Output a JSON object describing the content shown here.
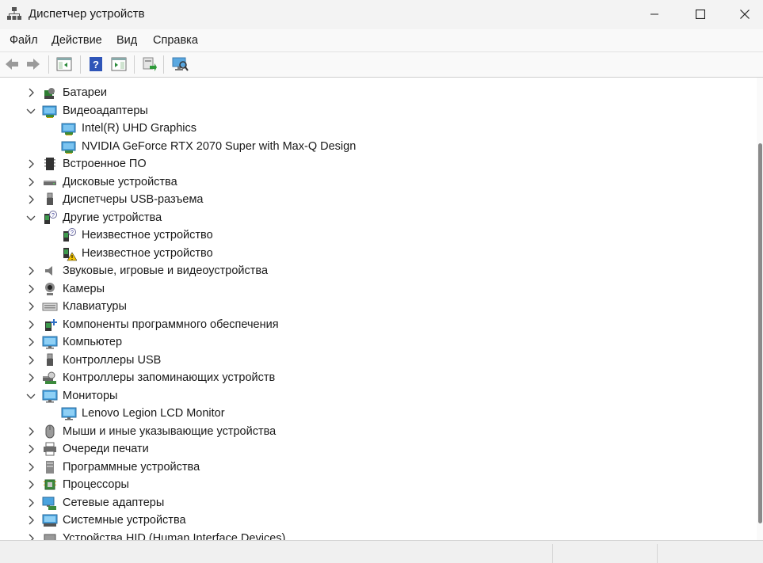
{
  "window": {
    "title": "Диспетчер устройств"
  },
  "menu": [
    "Файл",
    "Действие",
    "Вид",
    "Справка"
  ],
  "tree": [
    {
      "label": "Батареи",
      "expander": "collapsed",
      "icon": "battery-icon"
    },
    {
      "label": "Видеоадаптеры",
      "expander": "expanded",
      "icon": "display-adapter-icon"
    },
    {
      "label": "Intel(R) UHD Graphics",
      "expander": "none",
      "child": true,
      "icon": "display-adapter-icon"
    },
    {
      "label": "NVIDIA GeForce RTX 2070 Super with Max-Q Design",
      "expander": "none",
      "child": true,
      "icon": "display-adapter-icon"
    },
    {
      "label": "Встроенное ПО",
      "expander": "collapsed",
      "icon": "firmware-chip-icon"
    },
    {
      "label": "Дисковые устройства",
      "expander": "collapsed",
      "icon": "disk-drive-icon"
    },
    {
      "label": "Диспетчеры USB-разъема",
      "expander": "collapsed",
      "icon": "usb-connector-icon"
    },
    {
      "label": "Другие устройства",
      "expander": "expanded",
      "icon": "unknown-device-icon"
    },
    {
      "label": "Неизвестное устройство",
      "expander": "none",
      "child": true,
      "icon": "unknown-device-icon"
    },
    {
      "label": "Неизвестное устройство",
      "expander": "none",
      "child": true,
      "icon": "warning-device-icon"
    },
    {
      "label": "Звуковые, игровые и видеоустройства",
      "expander": "collapsed",
      "icon": "speaker-icon"
    },
    {
      "label": "Камеры",
      "expander": "collapsed",
      "icon": "webcam-icon"
    },
    {
      "label": "Клавиатуры",
      "expander": "collapsed",
      "icon": "keyboard-icon"
    },
    {
      "label": "Компоненты программного обеспечения",
      "expander": "collapsed",
      "icon": "software-component-icon"
    },
    {
      "label": "Компьютер",
      "expander": "collapsed",
      "icon": "computer-icon"
    },
    {
      "label": "Контроллеры USB",
      "expander": "collapsed",
      "icon": "usb-plug-icon"
    },
    {
      "label": "Контроллеры запоминающих устройств",
      "expander": "collapsed",
      "icon": "storage-controller-icon"
    },
    {
      "label": "Мониторы",
      "expander": "expanded",
      "icon": "monitor-icon"
    },
    {
      "label": "Lenovo Legion LCD Monitor",
      "expander": "none",
      "child": true,
      "icon": "monitor-icon"
    },
    {
      "label": "Мыши и иные указывающие устройства",
      "expander": "collapsed",
      "icon": "mouse-icon"
    },
    {
      "label": "Очереди печати",
      "expander": "collapsed",
      "icon": "printer-icon"
    },
    {
      "label": "Программные устройства",
      "expander": "collapsed",
      "icon": "software-device-icon"
    },
    {
      "label": "Процессоры",
      "expander": "collapsed",
      "icon": "processor-icon"
    },
    {
      "label": "Сетевые адаптеры",
      "expander": "collapsed",
      "icon": "network-adapter-icon"
    },
    {
      "label": "Системные устройства",
      "expander": "collapsed",
      "icon": "system-device-icon"
    },
    {
      "label": "Устройства HID (Human Interface Devices)",
      "expander": "collapsed",
      "icon": "hid-device-icon"
    }
  ]
}
